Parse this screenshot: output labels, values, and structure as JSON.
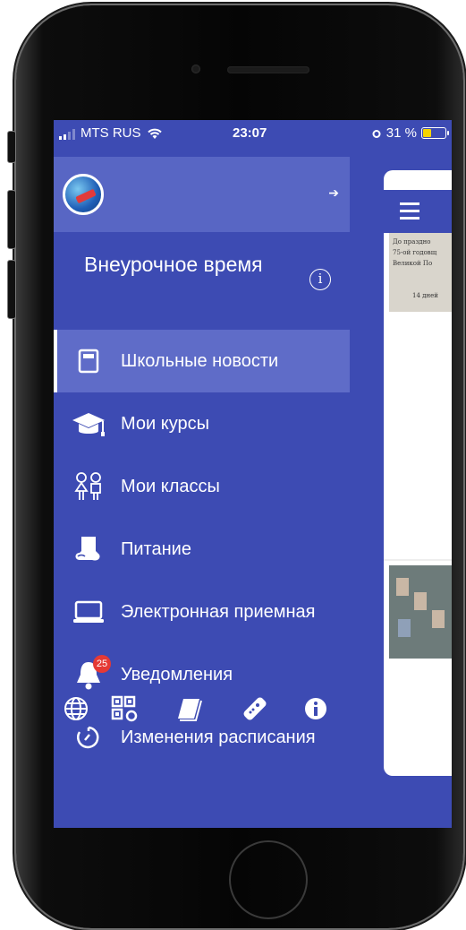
{
  "status_bar": {
    "carrier": "MTS RUS",
    "time": "23:07",
    "battery": "31 %",
    "battery_color": "#f5d400"
  },
  "drawer": {
    "school_name": "Внеурочное время",
    "menu": [
      {
        "label": "Школьные новости",
        "icon": "news-icon",
        "active": true
      },
      {
        "label": "Мои курсы",
        "icon": "graduation-cap-icon"
      },
      {
        "label": "Мои классы",
        "icon": "children-icon"
      },
      {
        "label": "Питание",
        "icon": "food-icon"
      },
      {
        "label": "Электронная приемная",
        "icon": "laptop-icon"
      },
      {
        "label": "Уведомления",
        "icon": "bell-icon",
        "badge": "25"
      },
      {
        "label": "Изменения расписания",
        "icon": "timer-icon"
      }
    ],
    "bottom_icons": [
      "globe-icon",
      "qr-scan-icon",
      "book-icon",
      "remote-icon",
      "info-icon"
    ]
  },
  "preview": {
    "news_lines": [
      "До праздно",
      "75-ой годовщ",
      "Великой По"
    ],
    "news_days": "14 дней"
  },
  "colors": {
    "drawer_bg": "#3d4bb3",
    "active_item": "#5f6cc8",
    "badge": "#e53935"
  }
}
